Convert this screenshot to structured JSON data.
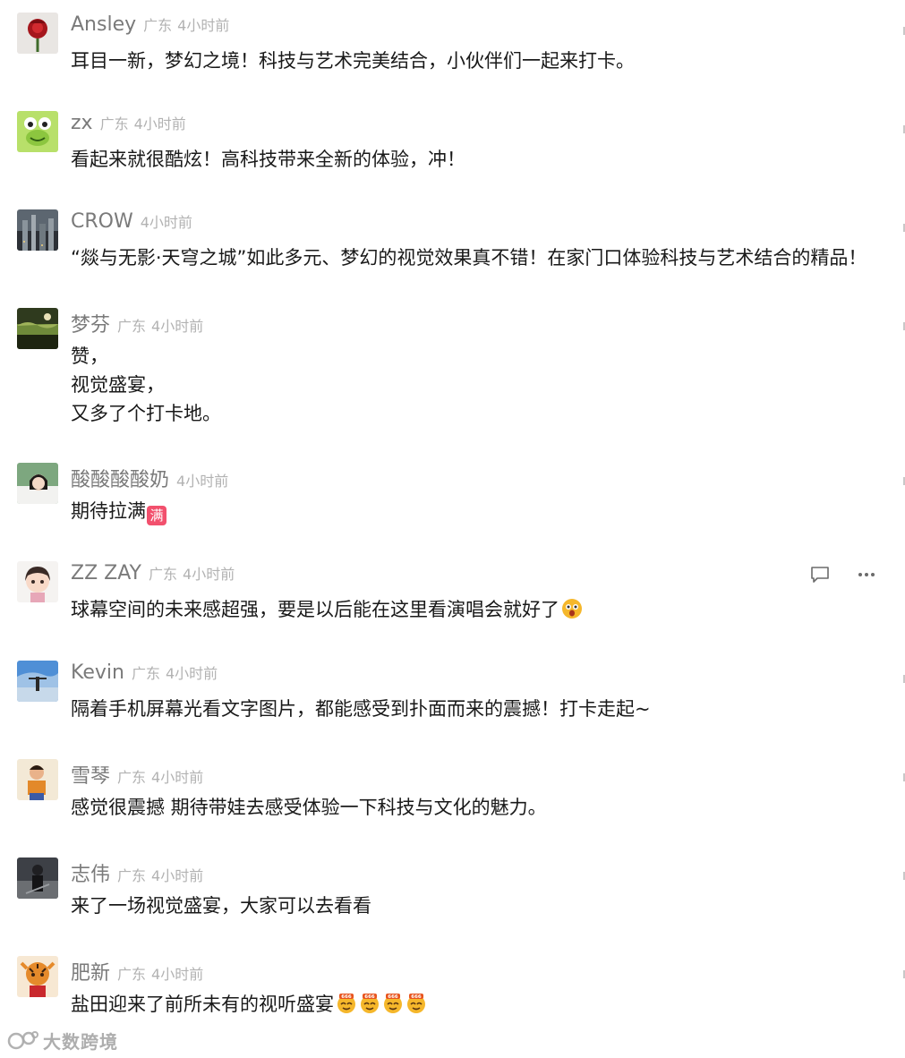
{
  "comments": [
    {
      "nickname": "Ansley",
      "location": "广东",
      "time": "4小时前",
      "lines": [
        "耳目一新，梦幻之境！科技与艺术完美结合，小伙伴们一起来打卡。"
      ],
      "avatar": "rose-avatar"
    },
    {
      "nickname": "zx",
      "location": "广东",
      "time": "4小时前",
      "lines": [
        "看起来就很酷炫！高科技带来全新的体验，冲！"
      ],
      "avatar": "frog-avatar"
    },
    {
      "nickname": "CROW",
      "location": "",
      "time": "4小时前",
      "lines": [
        "“燚与无影·天穹之城”如此多元、梦幻的视觉效果真不错！在家门口体验科技与艺术结合的精品！"
      ],
      "avatar": "city-avatar"
    },
    {
      "nickname": "梦芬",
      "location": "广东",
      "time": "4小时前",
      "lines": [
        "赞，",
        "视觉盛宴，",
        "又多了个打卡地。"
      ],
      "avatar": "landscape-avatar"
    },
    {
      "nickname": "酸酸酸酸奶",
      "location": "",
      "time": "4小时前",
      "lines": [
        "期待拉满"
      ],
      "badge": "满",
      "avatar": "girl-avatar"
    },
    {
      "nickname": "ZZ ZAY",
      "location": "广东",
      "time": "4小时前",
      "lines": [
        "球幕空间的未来感超强，要是以后能在这里看演唱会就好了"
      ],
      "emoji": [
        "surprised-emoji"
      ],
      "avatar": "cartoon-girl-avatar",
      "show_actions": true
    },
    {
      "nickname": "Kevin",
      "location": "广东",
      "time": "4小时前",
      "lines": [
        "隔着手机屏幕光看文字图片，都能感受到扑面而来的震撼！打卡走起~"
      ],
      "avatar": "sky-person-avatar"
    },
    {
      "nickname": "雪琴",
      "location": "广东",
      "time": "4小时前",
      "lines": [
        "感觉很震撼 期待带娃去感受体验一下科技与文化的魅力。"
      ],
      "avatar": "child-avatar"
    },
    {
      "nickname": "志伟",
      "location": "广东",
      "time": "4小时前",
      "lines": [
        "来了一场视觉盛宴，大家可以去看看"
      ],
      "avatar": "dark-figure-avatar"
    },
    {
      "nickname": "肥新",
      "location": "广东",
      "time": "4小时前",
      "lines": [
        "盐田迎来了前所未有的视听盛宴"
      ],
      "emoji": [
        "666-emoji",
        "666-emoji",
        "666-emoji",
        "666-emoji"
      ],
      "avatar": "tiger-avatar"
    }
  ],
  "actions": {
    "reply_icon": "comment-icon",
    "more_icon": "more-dots-icon"
  },
  "watermark": {
    "text": "大数跨境"
  },
  "colors": {
    "nickname": "#7a7a7a",
    "meta": "#b2b2b2",
    "text": "#191919",
    "badge": "#f2506d",
    "emoji": "#f5b72b"
  }
}
